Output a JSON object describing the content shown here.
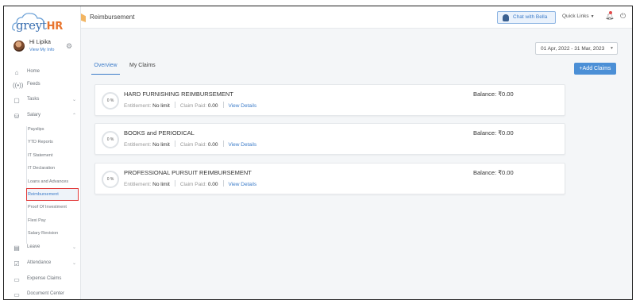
{
  "brand": {
    "logo_text": "greyt",
    "logo_accent": "HR"
  },
  "user": {
    "greeting": "Hi Lipika",
    "profile_link": "View My Info"
  },
  "nav": {
    "items": [
      {
        "label": "Home",
        "icon": "home-icon"
      },
      {
        "label": "Feeds",
        "icon": "feeds-icon"
      },
      {
        "label": "Tasks",
        "icon": "tasks-icon"
      },
      {
        "label": "Salary",
        "icon": "salary-icon"
      },
      {
        "label": "Leave",
        "icon": "leave-icon"
      },
      {
        "label": "Attendance",
        "icon": "attendance-icon"
      },
      {
        "label": "Expense Claims",
        "icon": "expense-icon"
      },
      {
        "label": "Document Center",
        "icon": "document-icon"
      }
    ],
    "salary_sub": [
      "Payslips",
      "YTD Reports",
      "IT Statement",
      "IT Declaration",
      "Loans and Advances",
      "Reimbursement",
      "Proof Of Investment",
      "Flexi Pay",
      "Salary Revision"
    ],
    "active_sub": "Reimbursement"
  },
  "header": {
    "title": "Reimbursement",
    "chat_label": "Chat with Bella",
    "quick_links": "Quick Links"
  },
  "main": {
    "date_range": "01 Apr, 2022 - 31 Mar, 2023",
    "tabs": [
      "Overview",
      "My Claims"
    ],
    "add_button": "+Add Claims",
    "claims": [
      {
        "title": "HARD FURNISHING REIMBURSEMENT",
        "progress": "0 %",
        "entitlement_label": "Entitlement:",
        "entitlement": "No limit",
        "paid_label": "Claim Paid:",
        "paid": "0.00",
        "link": "View Details",
        "balance": "Balance: ₹0.00"
      },
      {
        "title": "BOOKS and PERIODICAL",
        "progress": "0 %",
        "entitlement_label": "Entitlement:",
        "entitlement": "No limit",
        "paid_label": "Claim Paid:",
        "paid": "0.00",
        "link": "View Details",
        "balance": "Balance: ₹0.00"
      },
      {
        "title": "PROFESSIONAL PURSUIT REIMBURSEMENT",
        "progress": "0 %",
        "entitlement_label": "Entitlement:",
        "entitlement": "No limit",
        "paid_label": "Claim Paid:",
        "paid": "0.00",
        "link": "View Details",
        "balance": "Balance: ₹0.00"
      }
    ]
  },
  "colors": {
    "accent": "#3c7cc9",
    "button": "#4b8fd6",
    "highlight_border": "#e23b3b"
  }
}
